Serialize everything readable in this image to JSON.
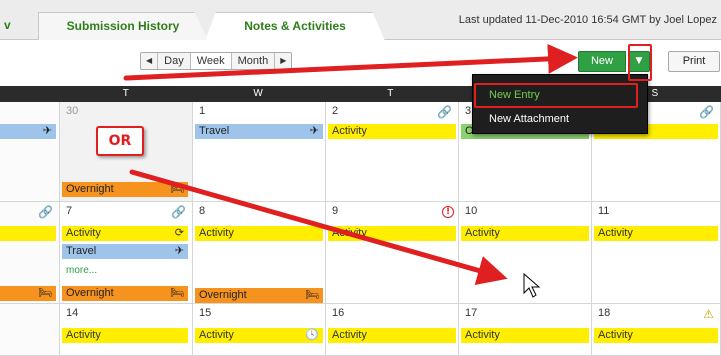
{
  "tabs": [
    {
      "label": "v"
    },
    {
      "label": "Submission History"
    },
    {
      "label": "Notes & Activities"
    }
  ],
  "last_updated": "Last updated 11-Dec-2010 16:54 GMT by Joel Lopez",
  "toolbar": {
    "prev_label": "◀",
    "day_label": "Day",
    "week_label": "Week",
    "month_label": "Month",
    "next_label": "▶",
    "new_label": "New",
    "dropdown_label": "▼",
    "print_label": "Print"
  },
  "day_headers": [
    "T",
    "W",
    "T",
    "F",
    "S"
  ],
  "weeks": [
    {
      "dates": [
        "",
        "30",
        "1",
        "2",
        "3",
        ""
      ]
    },
    {
      "dates": [
        "",
        "7",
        "8",
        "9",
        "10",
        "11"
      ]
    },
    {
      "dates": [
        "",
        "14",
        "15",
        "16",
        "17",
        "18"
      ]
    }
  ],
  "events": {
    "activity": "Activity",
    "travel": "Travel",
    "overnight": "Overnight",
    "more": "more...",
    "green_partial": "C"
  },
  "menu": {
    "items": [
      {
        "label": "New Entry"
      },
      {
        "label": "New Attachment"
      }
    ]
  },
  "annotation": {
    "or_label": "OR",
    "color": "#e02020"
  },
  "icons": {
    "plane": "✈",
    "paperclip": "🔗",
    "refresh": "⟳",
    "bed": "🛏",
    "alert": "!",
    "clock": "🕓",
    "warning": "⚠"
  },
  "colors": {
    "brand_green": "#2fa043",
    "activity_yellow": "#ffee00",
    "travel_blue": "#9fc4ec",
    "overnight_orange": "#f5931e",
    "header_dark": "#2b2b2b"
  }
}
